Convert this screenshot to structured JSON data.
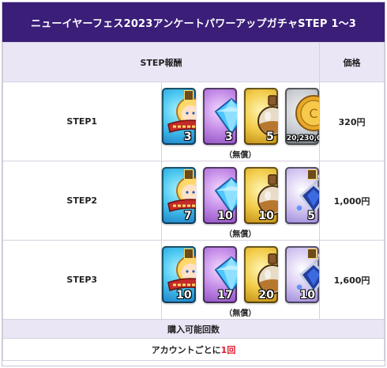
{
  "title": "ニューイヤーフェス2023アンケートパワーアップガチャSTEP 1〜3",
  "headers": {
    "reward": "STEP報酬",
    "price": "価格"
  },
  "steps": [
    {
      "label": "STEP1",
      "price": "320円",
      "note": "（無償）",
      "items": [
        {
          "icon": "powerup-ticket-icon",
          "count": "3"
        },
        {
          "icon": "blue-crystal-icon",
          "count": "3"
        },
        {
          "icon": "potion-flask-icon",
          "count": "5"
        },
        {
          "icon": "gold-coin-icon",
          "count": "20,230,000"
        }
      ]
    },
    {
      "label": "STEP2",
      "price": "1,000円",
      "note": "（無償）",
      "items": [
        {
          "icon": "powerup-ticket-icon",
          "count": "7"
        },
        {
          "icon": "blue-crystal-icon",
          "count": "10"
        },
        {
          "icon": "potion-flask-icon",
          "count": "10"
        },
        {
          "icon": "sapphire-pendant-icon",
          "count": "5"
        }
      ]
    },
    {
      "label": "STEP3",
      "price": "1,600円",
      "note": "（無償）",
      "items": [
        {
          "icon": "powerup-ticket-icon",
          "count": "10"
        },
        {
          "icon": "blue-crystal-icon",
          "count": "17"
        },
        {
          "icon": "potion-flask-icon",
          "count": "20"
        },
        {
          "icon": "sapphire-pendant-icon",
          "count": "10"
        }
      ]
    }
  ],
  "footer": {
    "label": "購入可能回数",
    "value_prefix": "アカウントごとに",
    "value_count": "1回"
  },
  "colors": {
    "title_bg": "#3a1e78",
    "header_bg": "#ebe6f6",
    "accent_red": "#e0192f"
  }
}
